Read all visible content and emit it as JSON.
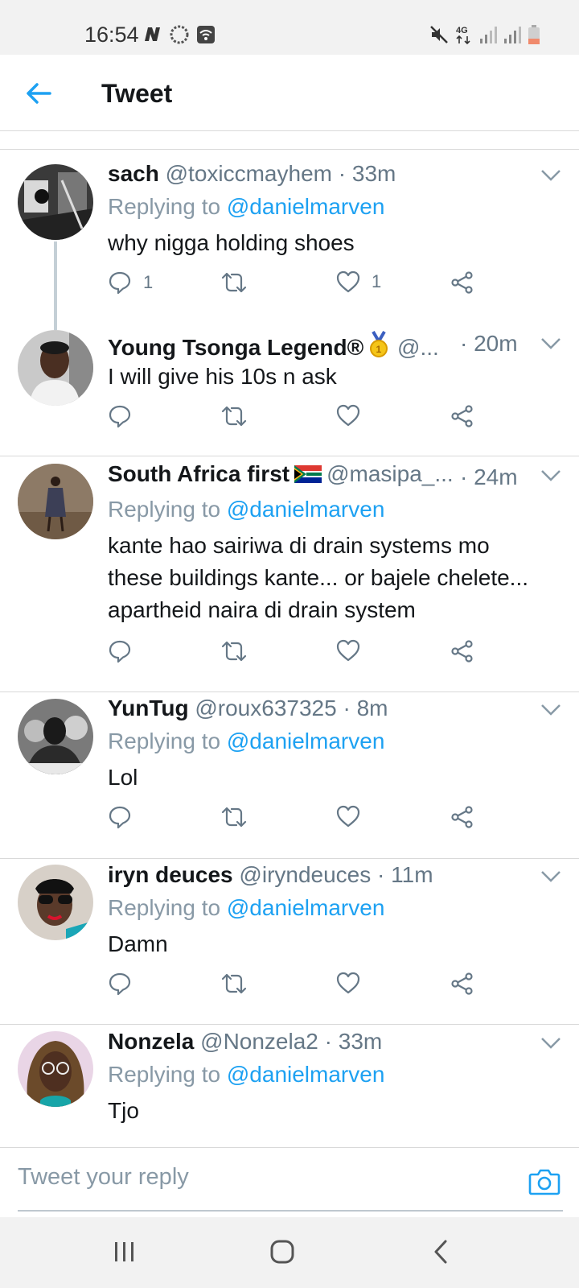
{
  "status_bar": {
    "time": "16:54",
    "left_icons": [
      "n-icon",
      "sync-icon",
      "wifi-box-icon"
    ],
    "right_icons": [
      "mute-icon",
      "4g-icon",
      "signal-icon",
      "signal-icon",
      "battery-low-icon"
    ]
  },
  "header": {
    "title": "Tweet",
    "back_icon": "arrow-left-icon",
    "accent": "#1da1f2"
  },
  "replies": [
    {
      "name": "sach",
      "handle": "@toxiccmayhem",
      "meta": "· 33m",
      "replying_prefix": "Replying to",
      "replying_to": "@danielmarven",
      "text": [
        "why nigga holding shoes"
      ],
      "reply_count": "1",
      "like_count": "1",
      "avatar": "bw-photo-avatar"
    },
    {
      "name": "Young Tsonga Legend®",
      "handle": "@...",
      "meta": "· 20m",
      "text": [
        "I will give his 10s n ask"
      ],
      "avatar": "man-photo-avatar"
    },
    {
      "name": "South Africa first",
      "flag": "south-africa-flag-icon",
      "handle": "@masipa_...",
      "meta": "· 24m",
      "replying_prefix": "Replying to",
      "replying_to": "@danielmarven",
      "text": [
        "kante hao sairiwa di drain systems mo",
        "these buildings kante... or bajele chelete...",
        "apartheid naira di drain system"
      ],
      "avatar": "woman-standing-avatar"
    },
    {
      "name": "YunTug",
      "handle": "@roux637325",
      "meta": "· 8m",
      "replying_prefix": "Replying to",
      "replying_to": "@danielmarven",
      "text": [
        "Lol"
      ],
      "avatar": "group-photo-avatar"
    },
    {
      "name": "iryn deuces",
      "handle": "@iryndeuces",
      "meta": "· 11m",
      "replying_prefix": "Replying to",
      "replying_to": "@danielmarven",
      "text": [
        "Damn"
      ],
      "avatar": "sunglasses-avatar"
    },
    {
      "name": "Nonzela",
      "handle": "@Nonzela2",
      "meta": "· 33m",
      "replying_prefix": "Replying to",
      "replying_to": "@danielmarven",
      "text": [
        "Tjo"
      ],
      "avatar": "glasses-woman-avatar"
    }
  ],
  "composer": {
    "placeholder": "Tweet your reply",
    "camera_icon": "camera-icon"
  },
  "nav_bar": [
    "recents-icon",
    "home-icon",
    "back-icon"
  ]
}
